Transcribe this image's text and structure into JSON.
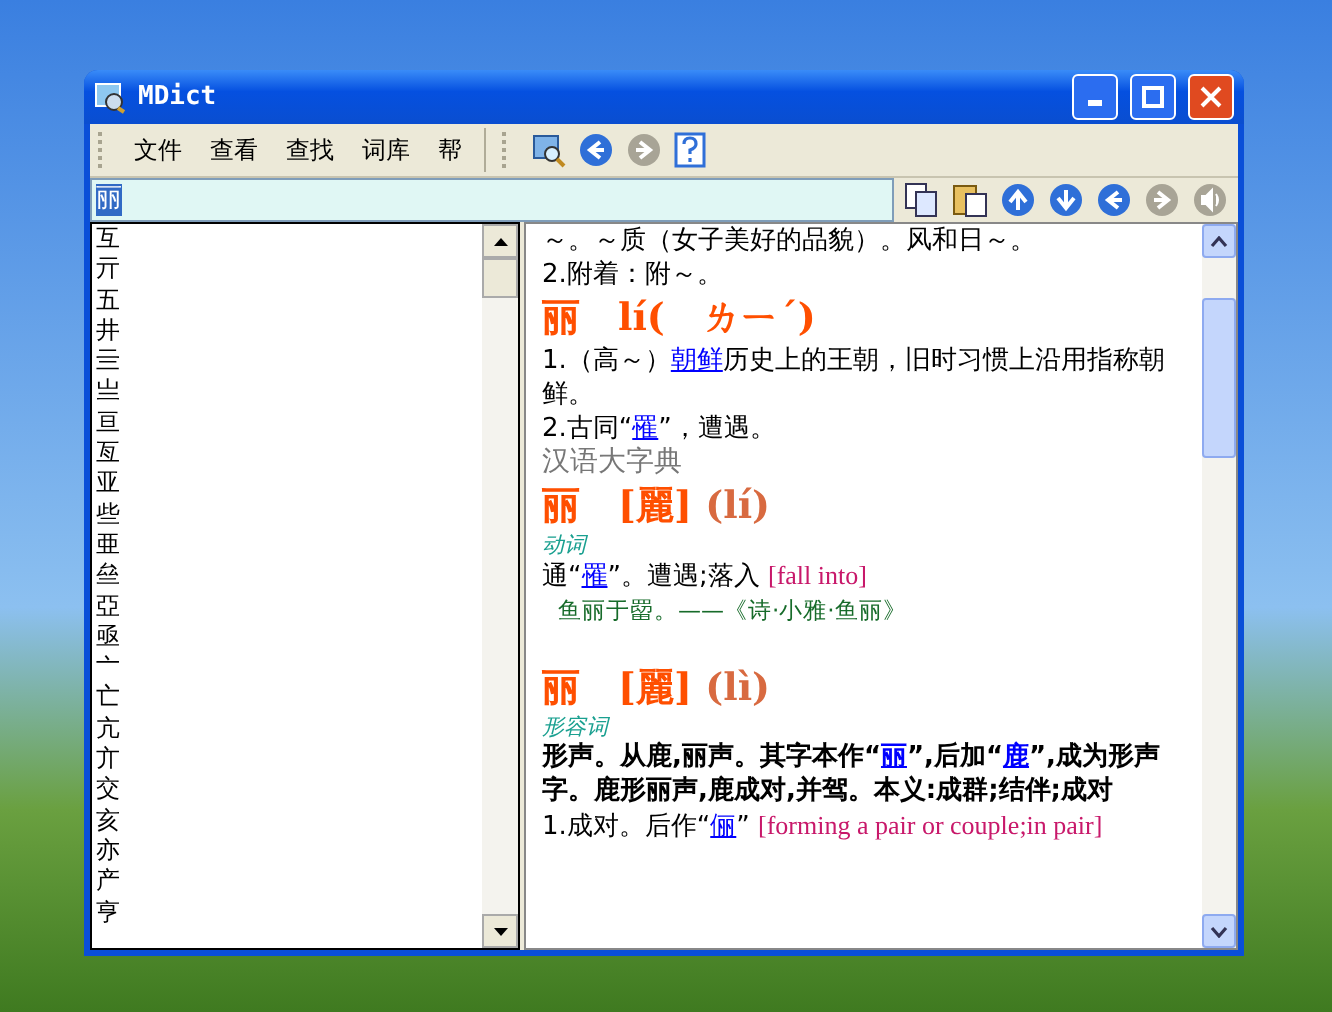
{
  "window": {
    "title": "MDict"
  },
  "menu": [
    "文件",
    "查看",
    "查找",
    "词库",
    "帮"
  ],
  "toolbar": [
    {
      "kind": "lookup",
      "disabled": false
    },
    {
      "kind": "back",
      "disabled": false
    },
    {
      "kind": "forward",
      "disabled": true
    },
    {
      "kind": "help",
      "disabled": false
    }
  ],
  "search": {
    "value": "丽"
  },
  "nav_buttons": [
    {
      "kind": "copy",
      "disabled": false
    },
    {
      "kind": "paste",
      "disabled": false
    },
    {
      "kind": "up",
      "disabled": false
    },
    {
      "kind": "down",
      "disabled": false
    },
    {
      "kind": "left",
      "disabled": false
    },
    {
      "kind": "right",
      "disabled": true
    },
    {
      "kind": "speak",
      "disabled": true
    }
  ],
  "word_list": [
    "互",
    "亓",
    "五",
    "井",
    "亖",
    "亗",
    "亘",
    "亙",
    "亚",
    "些",
    "亜",
    "亝",
    "亞",
    "亟",
    "亠",
    "亡",
    "亢",
    "亣",
    "交",
    "亥",
    "亦",
    "产",
    "亨"
  ],
  "entry": [
    {
      "kind": "text",
      "parts": [
        {
          "kind": "plain",
          "text": "～。～质（女子美好的品貌）。风和日～。"
        }
      ]
    },
    {
      "kind": "text",
      "parts": [
        {
          "kind": "plain",
          "text": "2.附着：附～。"
        }
      ]
    },
    {
      "kind": "heading",
      "parts": [
        {
          "kind": "plain",
          "text": "丽　lí(　ㄌㄧˊ)"
        }
      ]
    },
    {
      "kind": "text",
      "parts": [
        {
          "kind": "plain",
          "text": "1.（高～）"
        },
        {
          "kind": "link",
          "text": "朝鲜"
        },
        {
          "kind": "plain",
          "text": "历史上的王朝，旧时习惯上沿用指称朝鲜。"
        }
      ]
    },
    {
      "kind": "text",
      "parts": [
        {
          "kind": "plain",
          "text": "2.古同“"
        },
        {
          "kind": "link",
          "text": "罹"
        },
        {
          "kind": "plain",
          "text": "”，遭遇。"
        }
      ]
    },
    {
      "kind": "source",
      "parts": [
        {
          "kind": "plain",
          "text": "汉语大字典"
        }
      ]
    },
    {
      "kind": "heading",
      "parts": [
        {
          "kind": "plain",
          "text": "丽　[麗] "
        },
        {
          "kind": "pinyin",
          "text": "(lí)"
        }
      ]
    },
    {
      "kind": "pos",
      "parts": [
        {
          "kind": "plain",
          "text": "动词"
        }
      ]
    },
    {
      "kind": "text",
      "parts": [
        {
          "kind": "plain",
          "text": "通“"
        },
        {
          "kind": "link",
          "text": "罹"
        },
        {
          "kind": "plain",
          "text": "”。遭遇;落入 "
        },
        {
          "kind": "english",
          "text": "[fall into]"
        }
      ]
    },
    {
      "kind": "example",
      "parts": [
        {
          "kind": "plain",
          "text": "鱼丽于罶。——《诗·小雅·鱼丽》"
        }
      ]
    },
    {
      "kind": "heading",
      "parts": [
        {
          "kind": "plain",
          "text": "丽　[麗] "
        },
        {
          "kind": "pinyin",
          "text": "(lì)"
        }
      ]
    },
    {
      "kind": "pos",
      "parts": [
        {
          "kind": "plain",
          "text": "形容词"
        }
      ]
    },
    {
      "kind": "bold",
      "parts": [
        {
          "kind": "plain",
          "text": "形声。从鹿,丽声。其字本作“"
        },
        {
          "kind": "link",
          "text": "丽"
        },
        {
          "kind": "plain",
          "text": "”,后加“"
        },
        {
          "kind": "link",
          "text": "鹿"
        },
        {
          "kind": "plain",
          "text": "”,成为形声字。鹿形丽声,鹿成对,并驾。本义:成群;结伴;成对"
        }
      ]
    },
    {
      "kind": "text",
      "parts": [
        {
          "kind": "plain",
          "text": "1.成对。后作“"
        },
        {
          "kind": "link",
          "text": "俪"
        },
        {
          "kind": "plain",
          "text": "” "
        },
        {
          "kind": "english",
          "text": "[forming a pair or couple;in pair]"
        }
      ]
    }
  ]
}
